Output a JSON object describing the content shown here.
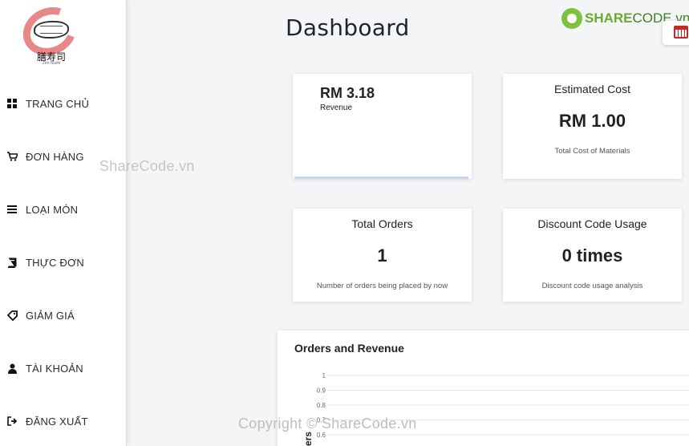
{
  "logo": {
    "text": "膳寿司",
    "subtext": "Zen Sushi"
  },
  "sidebar": {
    "items": [
      {
        "label": "TRANG CHỦ",
        "icon": "dashboard-grid-icon"
      },
      {
        "label": "ĐƠN HÀNG",
        "icon": "shopping-cart-icon"
      },
      {
        "label": "LOẠI MÓN",
        "icon": "list-icon"
      },
      {
        "label": "THỰC ĐƠN",
        "icon": "book-icon"
      },
      {
        "label": "GIẢM GIÁ",
        "icon": "tag-icon"
      },
      {
        "label": "TÀI KHOẢN",
        "icon": "user-icon"
      },
      {
        "label": "ĐĂNG XUẤT",
        "icon": "sign-out-icon"
      }
    ]
  },
  "header": {
    "title": "Dashboard",
    "brand_part1": "SHARE",
    "brand_part2": "CODE.vn"
  },
  "cards": {
    "revenue": {
      "value": "RM 3.18",
      "label": "Revenue"
    },
    "estimated_cost": {
      "title": "Estimated Cost",
      "value": "RM 1.00",
      "note": "Total Cost of Materials"
    },
    "total_orders": {
      "title": "Total Orders",
      "value": "1",
      "note": "Number of orders being placed by now"
    },
    "discount_usage": {
      "title": "Discount Code Usage",
      "value": "0 times",
      "note": "Discount code usage analysis"
    }
  },
  "chart": {
    "title": "Orders and Revenue",
    "y_ticks": [
      "1",
      "0.9",
      "0.8",
      "0.7",
      "0.6"
    ],
    "y_axis_label_partial": "ers"
  },
  "chart_data": {
    "type": "line",
    "title": "Orders and Revenue",
    "ylabel": "Orders",
    "ylim": [
      0,
      1
    ],
    "y_ticks": [
      1,
      0.9,
      0.8,
      0.7,
      0.6
    ],
    "grid": true
  },
  "watermarks": {
    "wm1": "ShareCode.vn",
    "wm2": "Copyright © ShareCode.vn"
  },
  "colors": {
    "accent_green": "#7cc242",
    "logo_red": "#e57373",
    "calendar_red": "#c62828"
  }
}
